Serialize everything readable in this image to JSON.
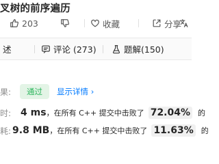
{
  "problem": {
    "title": "叉树的前序遍历"
  },
  "actions": {
    "like_count": "203",
    "favorite_label": "收藏",
    "share_label": "分享"
  },
  "tabs": [
    {
      "label": "述"
    },
    {
      "label": "评论 (273)"
    },
    {
      "label": "题解(150)"
    }
  ],
  "result": {
    "status_label": "果:",
    "status": "通过",
    "details_link": "显示详情 ›",
    "time_label": "时:",
    "time_value": "4 ms",
    "time_text": "，在所有 C++ 提交中击败了",
    "time_percent": "72.04%",
    "time_suffix": "的",
    "mem_label": "耗:",
    "mem_value": "9.8 MB",
    "mem_text": "，在所有 C++ 提交中击败了",
    "mem_percent": "11.63%",
    "mem_suffix": "的"
  },
  "colors": {
    "accepted_green": "#2db55d",
    "link_blue": "#007aff"
  }
}
